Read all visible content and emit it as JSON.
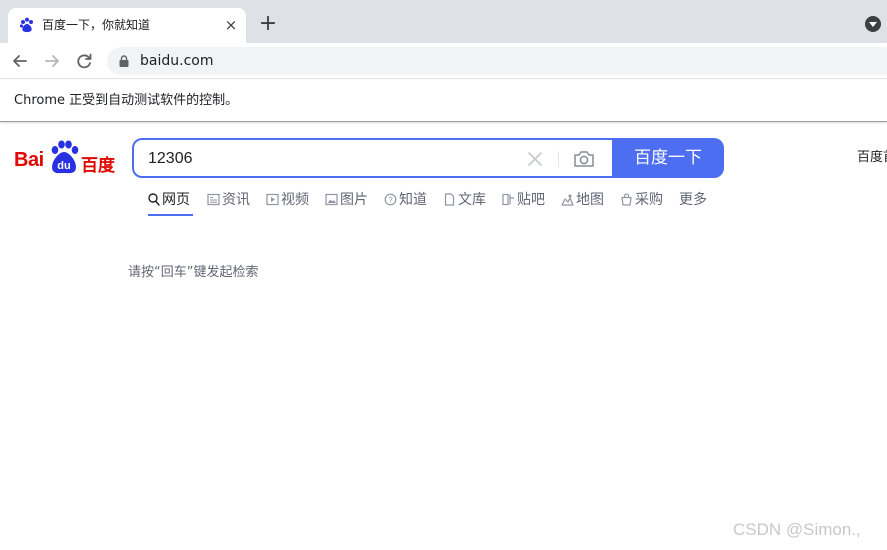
{
  "browser": {
    "tab": {
      "title": "百度一下，你就知道",
      "close": "×"
    },
    "new_tab": "+",
    "url": "baidu.com"
  },
  "infobar": {
    "text": "Chrome 正受到自动测试软件的控制。"
  },
  "baidu": {
    "logo": {
      "left_text": "Bai",
      "right_text": "百度",
      "paw_text": "du"
    },
    "search": {
      "value": "12306",
      "button": "百度一下"
    },
    "right_link": "百度首",
    "nav": [
      {
        "label": "网页",
        "icon": "search-icon"
      },
      {
        "label": "资讯",
        "icon": "news-icon"
      },
      {
        "label": "视频",
        "icon": "video-icon"
      },
      {
        "label": "图片",
        "icon": "image-icon"
      },
      {
        "label": "知道",
        "icon": "question-icon"
      },
      {
        "label": "文库",
        "icon": "doc-icon"
      },
      {
        "label": "贴吧",
        "icon": "tieba-icon"
      },
      {
        "label": "地图",
        "icon": "map-icon"
      },
      {
        "label": "采购",
        "icon": "shopping-icon"
      },
      {
        "label": "更多",
        "icon": ""
      }
    ],
    "hint": "请按“回车”键发起检索"
  },
  "watermark": "CSDN @Simon.,",
  "colors": {
    "accent": "#4e6ef2",
    "brand_red": "#e10601",
    "brand_blue": "#2932e1"
  }
}
